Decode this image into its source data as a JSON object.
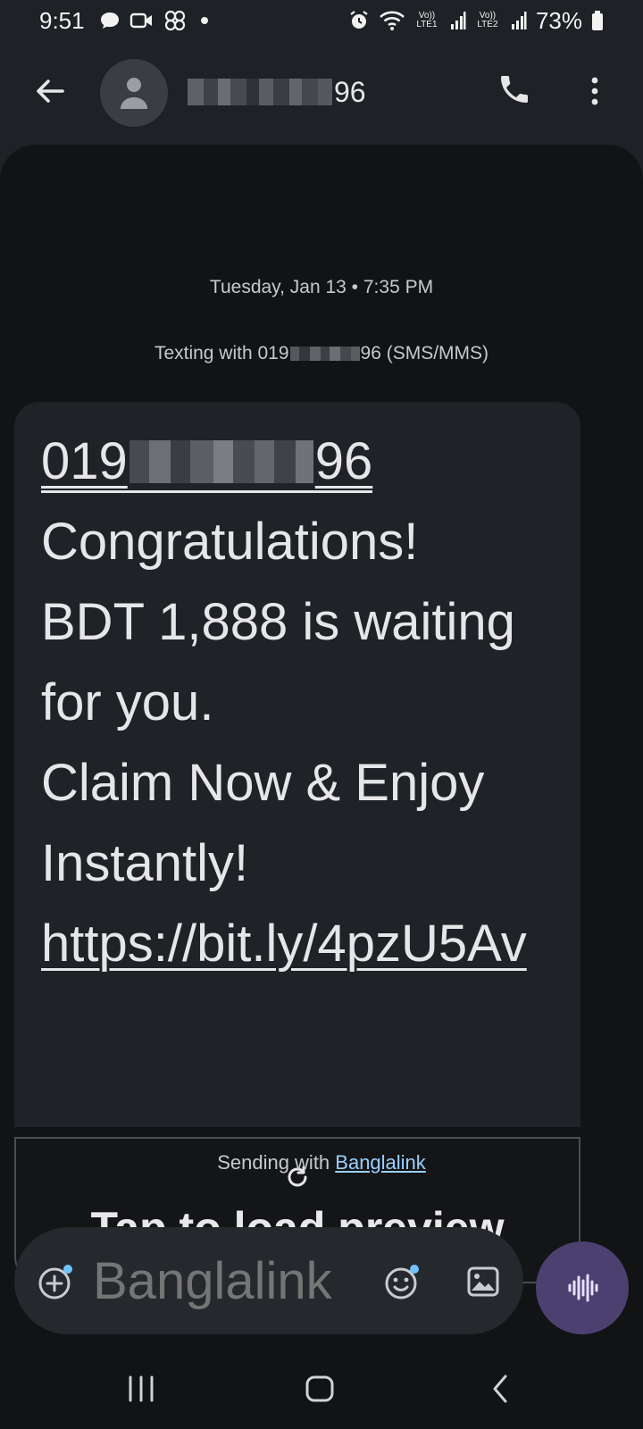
{
  "status_bar": {
    "time": "9:51",
    "battery": "73%",
    "sim1_tech": "Vo)) LTE1",
    "sim2_tech": "Vo)) LTE2"
  },
  "app_bar": {
    "contact_suffix": "96"
  },
  "conversation": {
    "date": "Tuesday, Jan 13 • 7:35 PM",
    "texting_prefix": "Texting with 019",
    "texting_suffix": "96 (SMS/MMS)"
  },
  "message": {
    "phone_prefix": "019",
    "phone_suffix": "96",
    "line1": "Congratulations!",
    "line2": "BDT 1,888 is waiting",
    "line3": "for you.",
    "line4": "Claim Now & Enjoy",
    "line5": "Instantly!",
    "link": "https://bit.ly/4pzU5Av"
  },
  "preview": {
    "label": "Tap to load preview"
  },
  "sending": {
    "prefix": "Sending with ",
    "carrier": "Banglalink"
  },
  "compose": {
    "placeholder": "Banglalink"
  },
  "icons": {
    "back": "arrow-left-icon",
    "avatar": "person-icon",
    "call": "phone-icon",
    "more": "more-vert-icon",
    "refresh": "refresh-icon",
    "attach": "add-circle-icon",
    "emoji": "emoji-icon",
    "gallery": "image-icon",
    "voice": "voice-waveform-icon"
  },
  "colors": {
    "background": "#1e2125",
    "panel": "#111315",
    "bubble": "#1f2226",
    "accent_link": "#9ad0ff",
    "voice_button": "#4c4070"
  }
}
